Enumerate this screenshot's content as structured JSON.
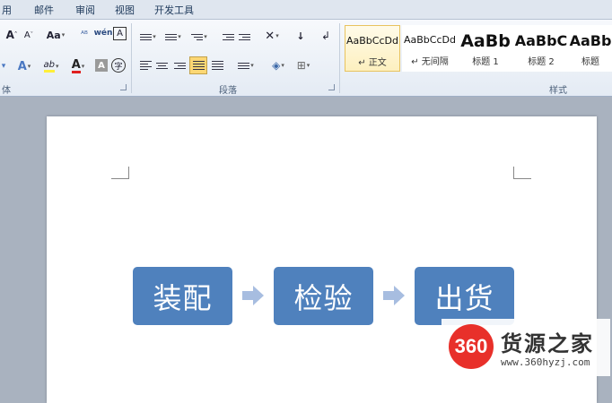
{
  "tabs": [
    {
      "label": "用"
    },
    {
      "label": "邮件"
    },
    {
      "label": "审阅"
    },
    {
      "label": "视图"
    },
    {
      "label": "开发工具"
    }
  ],
  "ribbon": {
    "font_group": {
      "label": "体",
      "grow_font": "A",
      "shrink_font": "A",
      "change_case": "Aa",
      "phonetic": "wén",
      "enclose": "A",
      "text_effect": "A",
      "highlight": "ab",
      "font_color": "A",
      "char_shading": "A",
      "enclose_char": "字"
    },
    "paragraph_group": {
      "label": "段落"
    },
    "styles_group": {
      "label": "样式",
      "styles": [
        {
          "sample": "AaBbCcDd",
          "name": "↵ 正文",
          "selected": true
        },
        {
          "sample": "AaBbCcDd",
          "name": "↵ 无间隔",
          "selected": false
        },
        {
          "sample": "AaBb",
          "name": "标题 1",
          "selected": false
        },
        {
          "sample": "AaBbC",
          "name": "标题 2",
          "selected": false
        },
        {
          "sample": "AaBb",
          "name": "标题",
          "selected": false
        }
      ]
    }
  },
  "document": {
    "process_steps": [
      "装配",
      "检验",
      "出货"
    ],
    "step_color": "#4f81bd",
    "arrow_color": "#a7bde0"
  },
  "watermark": {
    "logo": "360",
    "title": "货源之家",
    "url": "www.360hyzj.com",
    "logo_color": "#e8302a"
  }
}
